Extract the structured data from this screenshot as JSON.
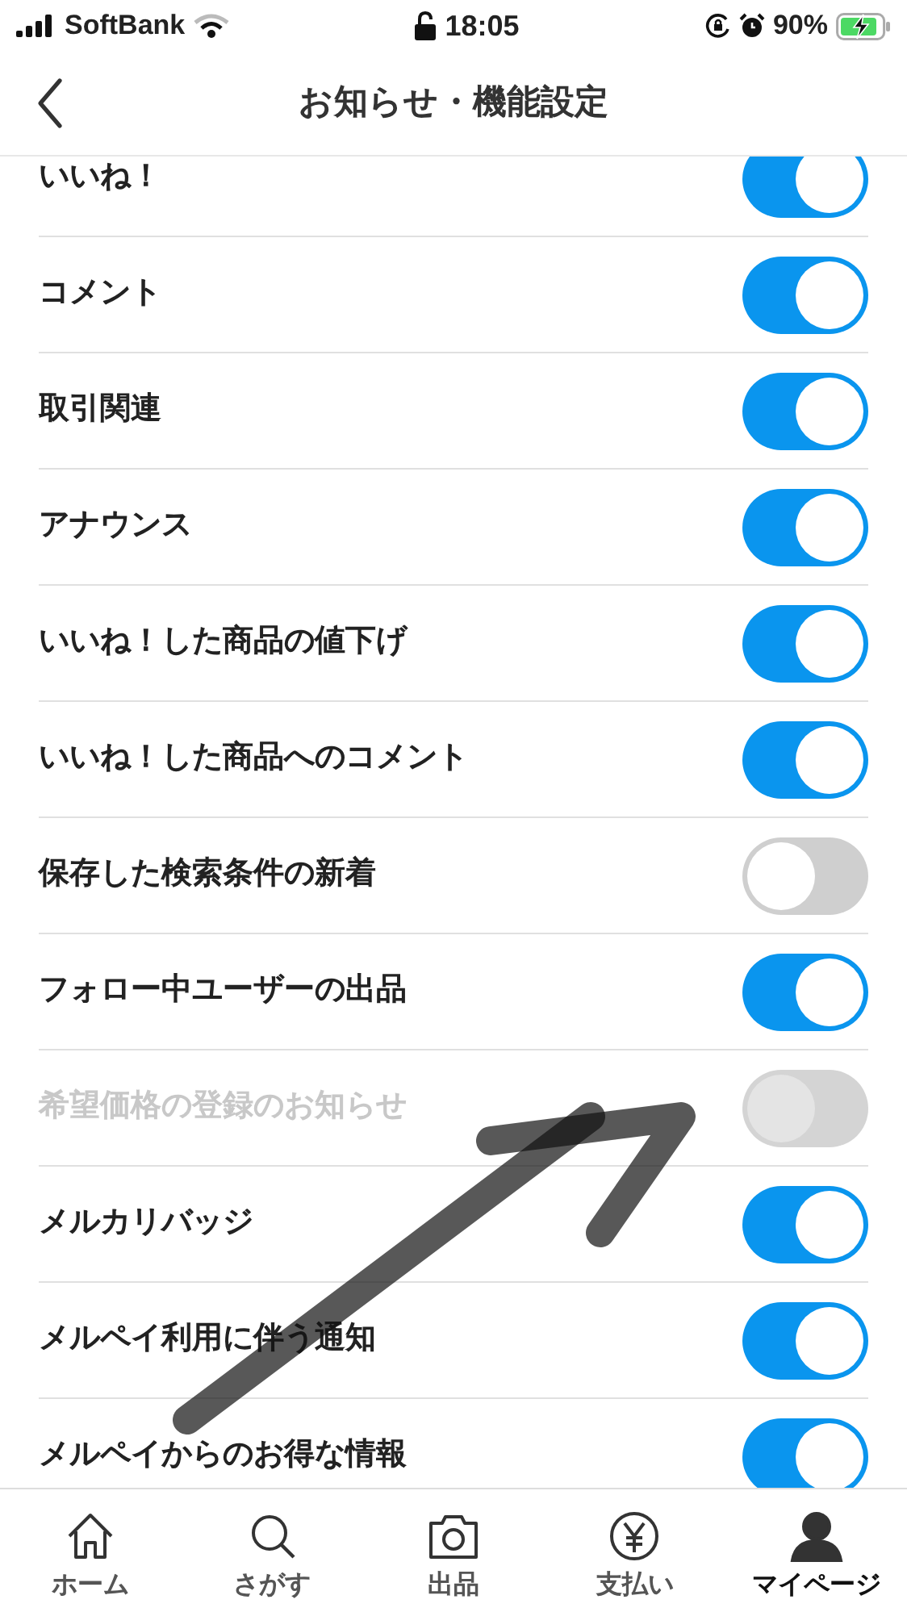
{
  "status_bar": {
    "carrier": "SoftBank",
    "time": "18:05",
    "battery": "90%"
  },
  "header": {
    "title": "お知らせ・機能設定"
  },
  "settings": [
    {
      "label": "いいね！",
      "on": true,
      "disabled": false
    },
    {
      "label": "コメント",
      "on": true,
      "disabled": false
    },
    {
      "label": "取引関連",
      "on": true,
      "disabled": false
    },
    {
      "label": "アナウンス",
      "on": true,
      "disabled": false
    },
    {
      "label": "いいね！した商品の値下げ",
      "on": true,
      "disabled": false
    },
    {
      "label": "いいね！した商品へのコメント",
      "on": true,
      "disabled": false
    },
    {
      "label": "保存した検索条件の新着",
      "on": false,
      "disabled": false
    },
    {
      "label": "フォロー中ユーザーの出品",
      "on": true,
      "disabled": false
    },
    {
      "label": "希望価格の登録のお知らせ",
      "on": false,
      "disabled": true
    },
    {
      "label": "メルカリバッジ",
      "on": true,
      "disabled": false
    },
    {
      "label": "メルペイ利用に伴う通知",
      "on": true,
      "disabled": false
    },
    {
      "label": "メルペイからのお得な情報",
      "on": true,
      "disabled": false
    }
  ],
  "tab_bar": [
    {
      "kind": "home",
      "label": "ホーム",
      "selected": false
    },
    {
      "kind": "search",
      "label": "さがす",
      "selected": false
    },
    {
      "kind": "camera",
      "label": "出品",
      "selected": false
    },
    {
      "kind": "yen",
      "label": "支払い",
      "selected": false
    },
    {
      "kind": "person",
      "label": "マイページ",
      "selected": true
    }
  ]
}
